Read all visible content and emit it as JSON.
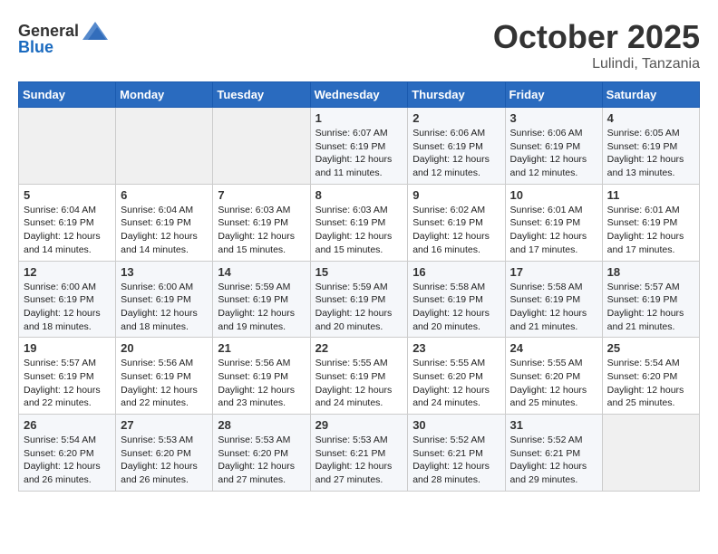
{
  "logo": {
    "general": "General",
    "blue": "Blue"
  },
  "header": {
    "month": "October 2025",
    "location": "Lulindi, Tanzania"
  },
  "weekdays": [
    "Sunday",
    "Monday",
    "Tuesday",
    "Wednesday",
    "Thursday",
    "Friday",
    "Saturday"
  ],
  "weeks": [
    [
      {
        "day": "",
        "info": ""
      },
      {
        "day": "",
        "info": ""
      },
      {
        "day": "",
        "info": ""
      },
      {
        "day": "1",
        "info": "Sunrise: 6:07 AM\nSunset: 6:19 PM\nDaylight: 12 hours\nand 11 minutes."
      },
      {
        "day": "2",
        "info": "Sunrise: 6:06 AM\nSunset: 6:19 PM\nDaylight: 12 hours\nand 12 minutes."
      },
      {
        "day": "3",
        "info": "Sunrise: 6:06 AM\nSunset: 6:19 PM\nDaylight: 12 hours\nand 12 minutes."
      },
      {
        "day": "4",
        "info": "Sunrise: 6:05 AM\nSunset: 6:19 PM\nDaylight: 12 hours\nand 13 minutes."
      }
    ],
    [
      {
        "day": "5",
        "info": "Sunrise: 6:04 AM\nSunset: 6:19 PM\nDaylight: 12 hours\nand 14 minutes."
      },
      {
        "day": "6",
        "info": "Sunrise: 6:04 AM\nSunset: 6:19 PM\nDaylight: 12 hours\nand 14 minutes."
      },
      {
        "day": "7",
        "info": "Sunrise: 6:03 AM\nSunset: 6:19 PM\nDaylight: 12 hours\nand 15 minutes."
      },
      {
        "day": "8",
        "info": "Sunrise: 6:03 AM\nSunset: 6:19 PM\nDaylight: 12 hours\nand 15 minutes."
      },
      {
        "day": "9",
        "info": "Sunrise: 6:02 AM\nSunset: 6:19 PM\nDaylight: 12 hours\nand 16 minutes."
      },
      {
        "day": "10",
        "info": "Sunrise: 6:01 AM\nSunset: 6:19 PM\nDaylight: 12 hours\nand 17 minutes."
      },
      {
        "day": "11",
        "info": "Sunrise: 6:01 AM\nSunset: 6:19 PM\nDaylight: 12 hours\nand 17 minutes."
      }
    ],
    [
      {
        "day": "12",
        "info": "Sunrise: 6:00 AM\nSunset: 6:19 PM\nDaylight: 12 hours\nand 18 minutes."
      },
      {
        "day": "13",
        "info": "Sunrise: 6:00 AM\nSunset: 6:19 PM\nDaylight: 12 hours\nand 18 minutes."
      },
      {
        "day": "14",
        "info": "Sunrise: 5:59 AM\nSunset: 6:19 PM\nDaylight: 12 hours\nand 19 minutes."
      },
      {
        "day": "15",
        "info": "Sunrise: 5:59 AM\nSunset: 6:19 PM\nDaylight: 12 hours\nand 20 minutes."
      },
      {
        "day": "16",
        "info": "Sunrise: 5:58 AM\nSunset: 6:19 PM\nDaylight: 12 hours\nand 20 minutes."
      },
      {
        "day": "17",
        "info": "Sunrise: 5:58 AM\nSunset: 6:19 PM\nDaylight: 12 hours\nand 21 minutes."
      },
      {
        "day": "18",
        "info": "Sunrise: 5:57 AM\nSunset: 6:19 PM\nDaylight: 12 hours\nand 21 minutes."
      }
    ],
    [
      {
        "day": "19",
        "info": "Sunrise: 5:57 AM\nSunset: 6:19 PM\nDaylight: 12 hours\nand 22 minutes."
      },
      {
        "day": "20",
        "info": "Sunrise: 5:56 AM\nSunset: 6:19 PM\nDaylight: 12 hours\nand 22 minutes."
      },
      {
        "day": "21",
        "info": "Sunrise: 5:56 AM\nSunset: 6:19 PM\nDaylight: 12 hours\nand 23 minutes."
      },
      {
        "day": "22",
        "info": "Sunrise: 5:55 AM\nSunset: 6:19 PM\nDaylight: 12 hours\nand 24 minutes."
      },
      {
        "day": "23",
        "info": "Sunrise: 5:55 AM\nSunset: 6:20 PM\nDaylight: 12 hours\nand 24 minutes."
      },
      {
        "day": "24",
        "info": "Sunrise: 5:55 AM\nSunset: 6:20 PM\nDaylight: 12 hours\nand 25 minutes."
      },
      {
        "day": "25",
        "info": "Sunrise: 5:54 AM\nSunset: 6:20 PM\nDaylight: 12 hours\nand 25 minutes."
      }
    ],
    [
      {
        "day": "26",
        "info": "Sunrise: 5:54 AM\nSunset: 6:20 PM\nDaylight: 12 hours\nand 26 minutes."
      },
      {
        "day": "27",
        "info": "Sunrise: 5:53 AM\nSunset: 6:20 PM\nDaylight: 12 hours\nand 26 minutes."
      },
      {
        "day": "28",
        "info": "Sunrise: 5:53 AM\nSunset: 6:20 PM\nDaylight: 12 hours\nand 27 minutes."
      },
      {
        "day": "29",
        "info": "Sunrise: 5:53 AM\nSunset: 6:21 PM\nDaylight: 12 hours\nand 27 minutes."
      },
      {
        "day": "30",
        "info": "Sunrise: 5:52 AM\nSunset: 6:21 PM\nDaylight: 12 hours\nand 28 minutes."
      },
      {
        "day": "31",
        "info": "Sunrise: 5:52 AM\nSunset: 6:21 PM\nDaylight: 12 hours\nand 29 minutes."
      },
      {
        "day": "",
        "info": ""
      }
    ]
  ]
}
